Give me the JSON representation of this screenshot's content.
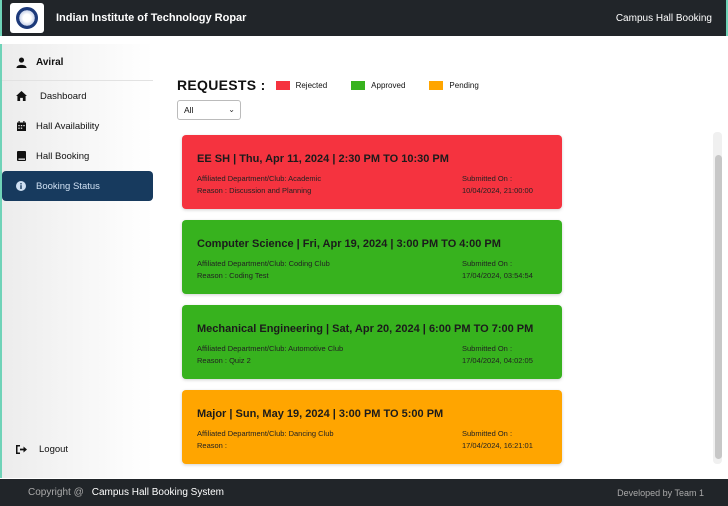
{
  "header": {
    "institute": "Indian Institute of Technology Ropar",
    "app_name": "Campus Hall Booking"
  },
  "sidebar": {
    "user": {
      "name": "Aviral",
      "icon": "user-icon"
    },
    "items": [
      {
        "label": "Dashboard",
        "icon": "home-icon"
      },
      {
        "label": "Hall Availability",
        "icon": "calendar-icon"
      },
      {
        "label": "Hall Booking",
        "icon": "book-icon"
      },
      {
        "label": "Booking Status",
        "icon": "info-icon",
        "active": true
      }
    ],
    "logout": {
      "label": "Logout",
      "icon": "logout-icon"
    }
  },
  "requests": {
    "title": "REQUESTS :",
    "legend": [
      {
        "label": "Rejected",
        "color": "#f5333f"
      },
      {
        "label": "Approved",
        "color": "#37b21e"
      },
      {
        "label": "Pending",
        "color": "#ffa500"
      }
    ],
    "filter": {
      "value": "All"
    },
    "cards": [
      {
        "title": "EE SH | Thu, Apr 11, 2024 | 2:30 PM TO 10:30 PM",
        "dept": "Affiliated Department/Club: Academic",
        "reason": "Reason : Discussion and Planning",
        "submitted_label": "Submitted On :",
        "submitted_value": "10/04/2024, 21:00:00",
        "status": "Rejected",
        "color": "#f5333f"
      },
      {
        "title": "Computer Science | Fri, Apr 19, 2024 | 3:00 PM TO 4:00 PM",
        "dept": "Affiliated Department/Club: Coding Club",
        "reason": "Reason : Coding Test",
        "submitted_label": "Submitted On :",
        "submitted_value": "17/04/2024, 03:54:54",
        "status": "Approved",
        "color": "#37b21e"
      },
      {
        "title": "Mechanical Engineering | Sat, Apr 20, 2024 | 6:00 PM TO 7:00 PM",
        "dept": "Affiliated Department/Club: Automotive Club",
        "reason": "Reason : Quiz 2",
        "submitted_label": "Submitted On :",
        "submitted_value": "17/04/2024, 04:02:05",
        "status": "Approved",
        "color": "#37b21e"
      },
      {
        "title": "Major | Sun, May 19, 2024 | 3:00 PM TO 5:00 PM",
        "dept": "Affiliated Department/Club: Dancing Club",
        "reason": "Reason :",
        "submitted_label": "Submitted On :",
        "submitted_value": "17/04/2024, 16:21:01",
        "status": "Pending",
        "color": "#ffa500"
      }
    ]
  },
  "footer": {
    "copyright": "Copyright @",
    "system": "Campus Hall Booking System",
    "developer": "Developed by Team 1"
  }
}
